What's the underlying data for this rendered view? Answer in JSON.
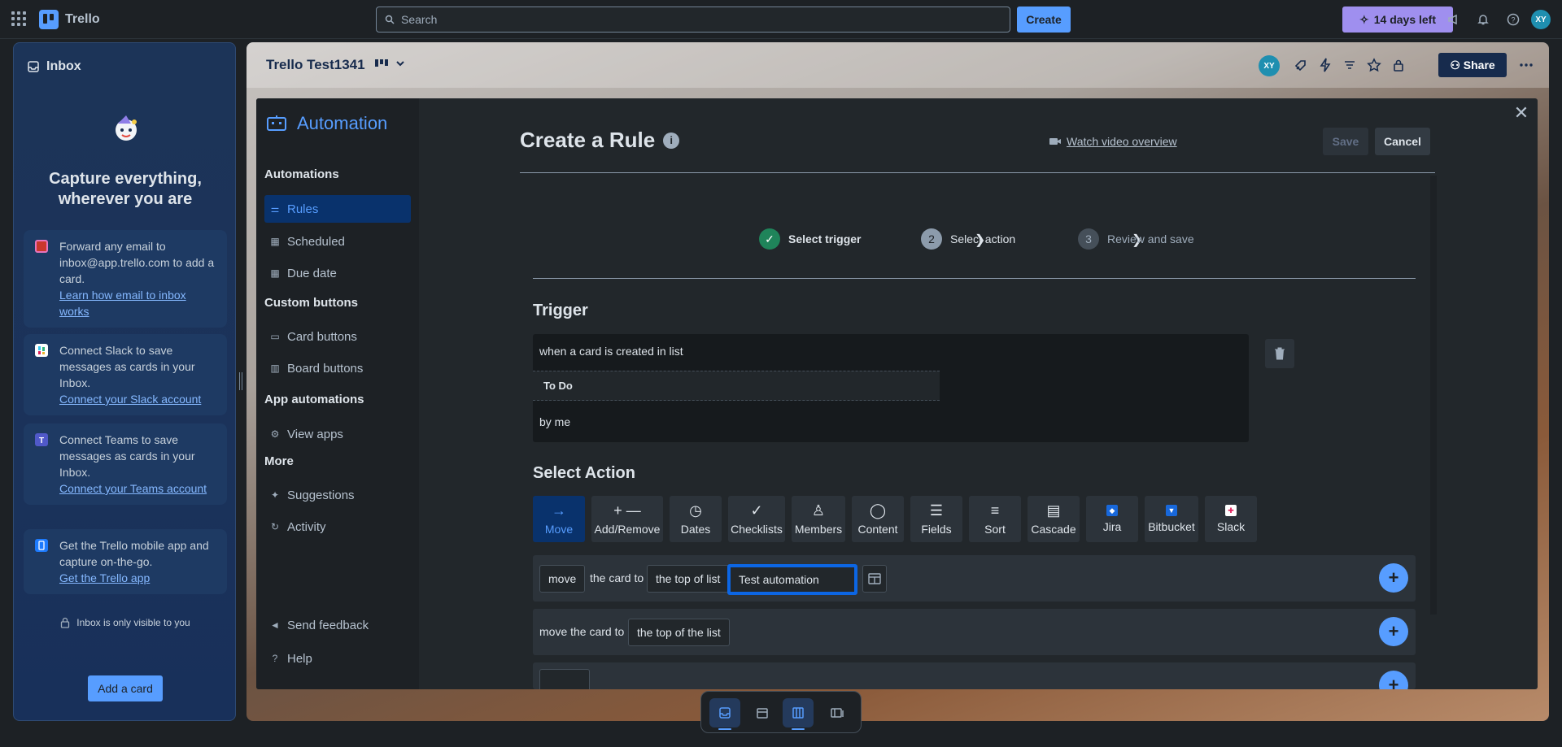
{
  "topbar": {
    "app_name": "Trello",
    "search_placeholder": "Search",
    "create_label": "Create",
    "trial_label": "14 days left",
    "avatar_initials": "XY"
  },
  "inbox": {
    "title": "Inbox",
    "headline": "Capture everything, wherever you are",
    "cards": [
      {
        "text": "Forward any email to inbox@app.trello.com to add a card.",
        "link": "Learn how email to inbox works"
      },
      {
        "text": "Connect Slack to save messages as cards in your Inbox.",
        "link": "Connect your Slack account"
      },
      {
        "text": "Connect Teams to save messages as cards in your Inbox.",
        "link": "Connect your Teams account"
      },
      {
        "text": "Get the Trello mobile app and capture on-the-go.",
        "link": "Get the Trello app"
      }
    ],
    "private_note": "Inbox is only visible to you",
    "add_card_label": "Add a card"
  },
  "board": {
    "title": "Trello Test1341",
    "share_label": "Share",
    "avatar_initials": "XY"
  },
  "automation": {
    "brand": "Automation",
    "nav": {
      "section_automations": "Automations",
      "rules": "Rules",
      "scheduled": "Scheduled",
      "due_date": "Due date",
      "section_custom": "Custom buttons",
      "card_buttons": "Card buttons",
      "board_buttons": "Board buttons",
      "section_app": "App automations",
      "view_apps": "View apps",
      "section_more": "More",
      "suggestions": "Suggestions",
      "activity": "Activity",
      "send_feedback": "Send feedback",
      "help": "Help"
    },
    "rule": {
      "title": "Create a Rule",
      "watch_label": "Watch video overview",
      "save_label": "Save",
      "cancel_label": "Cancel",
      "steps": [
        {
          "number": "",
          "label": "Select trigger",
          "state": "done"
        },
        {
          "number": "2",
          "label": "Select action",
          "state": "current"
        },
        {
          "number": "3",
          "label": "Review and save",
          "state": "pending"
        }
      ],
      "trigger_title": "Trigger",
      "trigger_line1": "when a card is created in list",
      "trigger_list": "To Do",
      "trigger_line3": "by me",
      "action_title": "Select Action",
      "action_tabs": [
        "Move",
        "Add/Remove",
        "Dates",
        "Checklists",
        "Members",
        "Content",
        "Fields",
        "Sort",
        "Cascade",
        "Jira",
        "Bitbucket",
        "Slack"
      ],
      "row1": {
        "move_field": "move",
        "text1": "the card to",
        "position_field": "the top of list",
        "list_input_value": "Test automation"
      },
      "row2": {
        "text1": "move the card to",
        "position_field": "the top of the list"
      }
    }
  }
}
